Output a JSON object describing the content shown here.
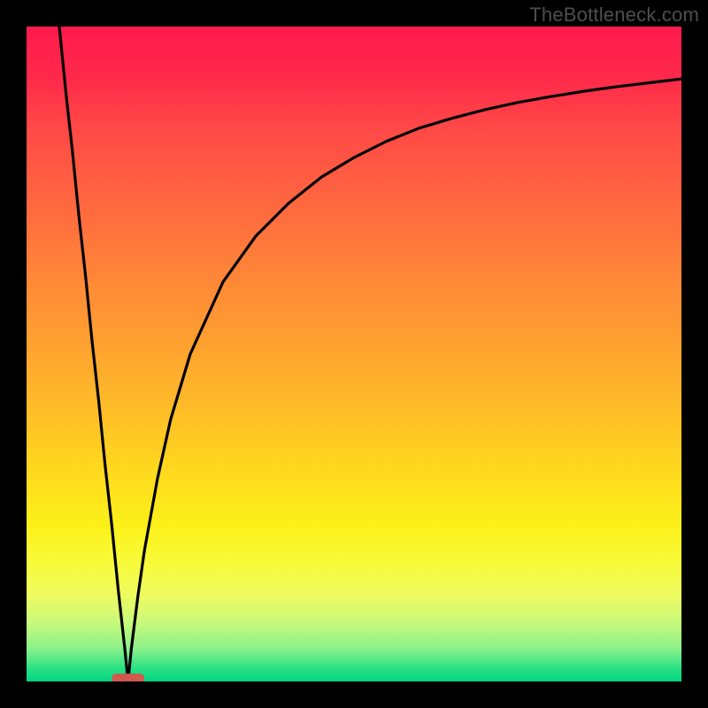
{
  "watermark": "TheBottleneck.com",
  "chart_data": {
    "type": "line",
    "title": "",
    "xlabel": "",
    "ylabel": "",
    "xlim": [
      0,
      100
    ],
    "ylim": [
      0,
      100
    ],
    "background_gradient": {
      "top_color": "#ff1a4d",
      "bottom_color": "#00d680",
      "meaning_top": "high bottleneck",
      "meaning_bottom": "no bottleneck"
    },
    "optimal_x": 15.5,
    "optimal_marker": {
      "shape": "rounded-rect",
      "color": "#d1594f",
      "x": 15.5,
      "y": 0.5,
      "width": 5,
      "height": 1.4
    },
    "series": [
      {
        "name": "bottleneck-curve",
        "x": [
          5,
          6,
          7,
          8,
          9,
          10,
          11,
          12,
          13,
          14,
          15,
          15.5,
          16,
          17,
          18,
          20,
          22,
          25,
          30,
          35,
          40,
          45,
          50,
          55,
          60,
          65,
          70,
          75,
          80,
          85,
          90,
          95,
          100
        ],
        "y": [
          100,
          90,
          81,
          71,
          62,
          52,
          43,
          33,
          24,
          14,
          5,
          0,
          5,
          13,
          20,
          31,
          40,
          50,
          61,
          68,
          73,
          77,
          80,
          82.5,
          84.5,
          86,
          87.3,
          88.4,
          89.3,
          90.1,
          90.8,
          91.4,
          92
        ]
      }
    ]
  }
}
